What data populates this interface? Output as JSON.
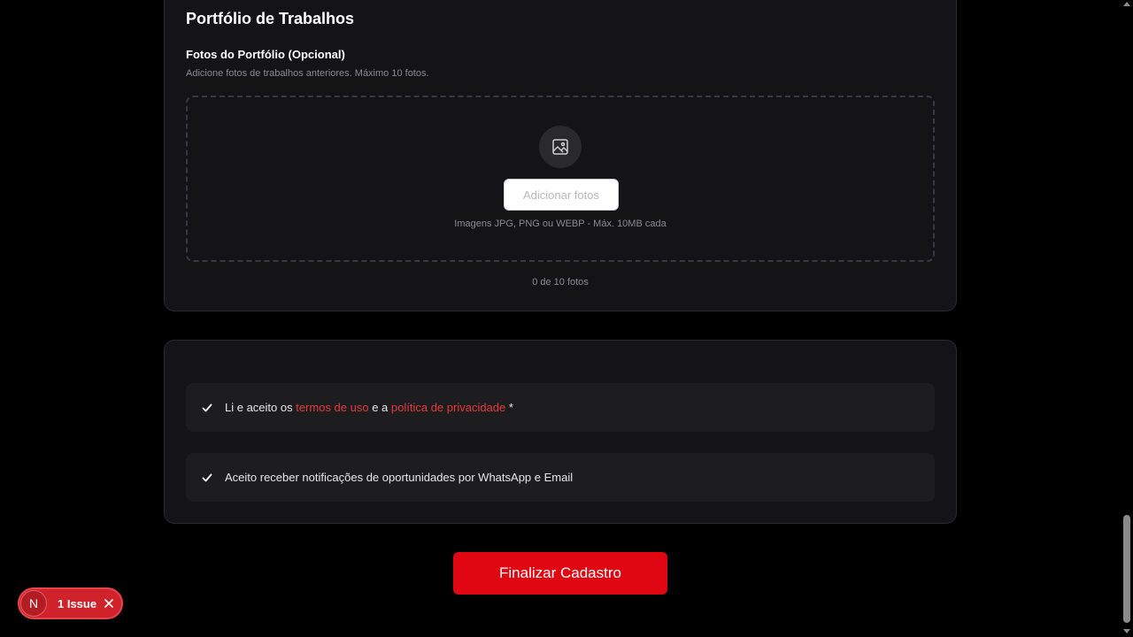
{
  "portfolio": {
    "title": "Portfólio de Trabalhos",
    "photos_label": "Fotos do Portfólio (Opcional)",
    "photos_help": "Adicione fotos de trabalhos anteriores. Máximo 10 fotos.",
    "add_button": "Adicionar fotos",
    "file_hint": "Imagens JPG, PNG ou WEBP - Máx. 10MB cada",
    "count_text": "0 de 10 fotos",
    "icon": "image-icon"
  },
  "terms": {
    "terms_prefix": "Li e aceito os ",
    "terms_link": "termos de uso",
    "terms_middle": " e a ",
    "privacy_link": "política de privacidade",
    "terms_suffix": " *",
    "notifications": "Aceito receber notificações de oportunidades por WhatsApp e Email",
    "terms_checked": true,
    "notifications_checked": true
  },
  "submit_button": "Finalizar Cadastro",
  "dev_indicator": {
    "badge": "N",
    "label": "1 Issue"
  },
  "colors": {
    "accent": "#e00712",
    "link": "#e63a3a",
    "card_bg": "#141416",
    "background": "#000000"
  }
}
